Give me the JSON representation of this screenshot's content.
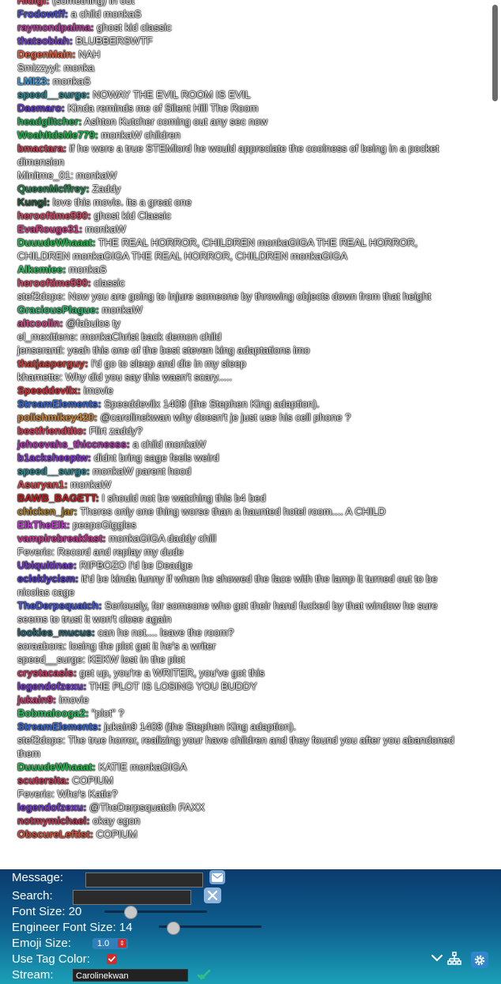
{
  "messages": [
    {
      "user": "Hidigi",
      "color": "#e0425d",
      "text": "(something) in out"
    },
    {
      "user": "Frodowtff",
      "color": "#4f4fd8",
      "text": "a child monkaS"
    },
    {
      "user": "raymondpalma",
      "color": "#c23ea4",
      "text": "ghost kid classic"
    },
    {
      "user": "thatsobiah",
      "color": "#7c45d8",
      "text": "BLUBBERSWTF"
    },
    {
      "user": "DegenMain",
      "color": "#f06545",
      "text": "NAH"
    },
    {
      "user": "",
      "color": "",
      "text": "Smizzyyl: monka"
    },
    {
      "user": "LMI23",
      "color": "#3fa4e8",
      "text": "monkaS"
    },
    {
      "user": "speed__surge",
      "color": "#2a8f9a",
      "text": "NOWAY THE EVIL ROOM IS EVIL"
    },
    {
      "user": "Daemaro",
      "color": "#6a3bd8",
      "text": "Kinda reminds me of Silent Hill The Room"
    },
    {
      "user": "headglitcher",
      "color": "#28b85c",
      "text": "Ashton Kutcher coming out any sec now"
    },
    {
      "user": "WoahItdsMe779",
      "color": "#1ebe4c",
      "text": "monkaW children"
    },
    {
      "user": "bmactara",
      "color": "#d8405a",
      "text": "if he were a true STEMlord he would appreciate the coolness of being in a pocket dimension"
    },
    {
      "user": "",
      "color": "",
      "text": "Minitme_01: monkaW"
    },
    {
      "user": "QueenMcffrey",
      "color": "#2e8b57",
      "text": "Zaddy"
    },
    {
      "user": "Kungi",
      "color": "#2a5a3a",
      "text": "love this movie. its a great one"
    },
    {
      "user": "herooftime590",
      "color": "#d84a6a",
      "text": "ghost kid Classic"
    },
    {
      "user": "EvaRouge31",
      "color": "#d8408a",
      "text": "monkaW"
    },
    {
      "user": "DuuudeWhaaat",
      "color": "#24c450",
      "text": "THE REAL HORROR, CHILDREN monkaGIGA THE REAL HORROR, CHILDREN monkaGIGA THE REAL HORROR, CHILDREN monkaGIGA"
    },
    {
      "user": "Alkemiee",
      "color": "#28c860",
      "text": "monkaS"
    },
    {
      "user": "herooftime590",
      "color": "#d84a6a",
      "text": "classic"
    },
    {
      "user": "",
      "color": "",
      "text": "stef2dope: Now you are going to injure someone by throwing objects down from that height"
    },
    {
      "user": "GraciousPlague",
      "color": "#2ec070",
      "text": "monkaW"
    },
    {
      "user": "altcoolin",
      "color": "#d84a8a",
      "text": "@fabulos ty"
    },
    {
      "user": "",
      "color": "",
      "text": "el_mexitiene: monkaChrist back demon child"
    },
    {
      "user": "",
      "color": "",
      "text": "jenseranti: yeah this one of the best steven king adaptations imo"
    },
    {
      "user": "thatjasperguy",
      "color": "#d8403a",
      "text": "I'd go to sleep and die in my sleep"
    },
    {
      "user": "",
      "color": "",
      "text": "khamette: Why did you say this wasn't scary....."
    },
    {
      "user": "Speeddevilx",
      "color": "#e0303a",
      "text": "imovie"
    },
    {
      "user": "StreamElements",
      "color": "#3a6ae0",
      "text": "Speeddevilx 1408 (the Stephen King adaption)."
    },
    {
      "user": "polishmikey420",
      "color": "#d88a3a",
      "text": "@carolinekwan why doesn't je just use his cell phone ?"
    },
    {
      "user": "bestfriendtito",
      "color": "#e0405a",
      "text": "Flirt zaddy?"
    },
    {
      "user": "jehoevahs_thiccnesss",
      "color": "#b83ab8",
      "text": "a child monkaW"
    },
    {
      "user": "b1acksheeptw",
      "color": "#8a3ad8",
      "text": "didnt bring sage feels weird"
    },
    {
      "user": "speed__surge",
      "color": "#2a8f9a",
      "text": "monkaW parent hood"
    },
    {
      "user": "Asuryan1",
      "color": "#e04a4a",
      "text": "monkaW"
    },
    {
      "user": "BAWB_BAGETT",
      "color": "#c82020",
      "text": "I should not be watching this b4 bed"
    },
    {
      "user": "chicken_jar",
      "color": "#b8862a",
      "text": "Theres only one thing worse than a haunted hotel room.... A CHILD"
    },
    {
      "user": "ElkTheElk",
      "color": "#c83ad8",
      "text": "peepoGiggles"
    },
    {
      "user": "vampirebreakfast",
      "color": "#d83a9a",
      "text": "monkaGIGA daddy chill"
    },
    {
      "user": "",
      "color": "",
      "text": "Feverio: Record and replay my dude"
    },
    {
      "user": "Ubiquitinae",
      "color": "#7a3ad8",
      "text": "RIPBOZO I'd be Deadge"
    },
    {
      "user": "ecleklycism",
      "color": "#5a3ad8",
      "text": "it'd be kinda funny if when he showed the face with the lamp it turned out to be nicolas cage"
    },
    {
      "user": "TheDerpsquatch",
      "color": "#4a5ae0",
      "text": "Seriously, for someone who got their hand fucked by that window he sure seems to trust it won't close again"
    },
    {
      "user": "lookies_mucus",
      "color": "#2a6a7a",
      "text": "can he not.... leave the room?"
    },
    {
      "user": "",
      "color": "",
      "text": "soraabora: losing the plot get it he's a writer"
    },
    {
      "user": "",
      "color": "",
      "text": "speed__surge: KEKW lost in the plot"
    },
    {
      "user": "crystacasis",
      "color": "#d83a6a",
      "text": "get up, you're a WRITER, you've got this"
    },
    {
      "user": "legendofzexu",
      "color": "#7a3ad8",
      "text": "THE PLOT IS LOSING YOU BUDDY"
    },
    {
      "user": "jukain9",
      "color": "#d83a7a",
      "text": "imovie"
    },
    {
      "user": "Bobmalooga2",
      "color": "#28c860",
      "text": "\"plot\" ?"
    },
    {
      "user": "StreamElements",
      "color": "#3a6ae0",
      "text": "jukain9 1408 (the Stephen King adaption)."
    },
    {
      "user": "",
      "color": "",
      "text": "stef2dope: The true horror, realizing your have children and they found you after you abandoned them"
    },
    {
      "user": "DuuudeWhaaat",
      "color": "#24c450",
      "text": "KATIE monkaGIGA"
    },
    {
      "user": "scutersita",
      "color": "#d83a5a",
      "text": "COPIUM"
    },
    {
      "user": "",
      "color": "",
      "text": "Feverio: Who's Katie?"
    },
    {
      "user": "legendofzexu",
      "color": "#7a3ad8",
      "text": "@TheDerpsquatch FAXX"
    },
    {
      "user": "notmymichael",
      "color": "#c83a5a",
      "text": "okay egon"
    },
    {
      "user": "ObscureLeftist",
      "color": "#e0503a",
      "text": "COPIUM"
    }
  ],
  "panel": {
    "message_label": "Message:",
    "message_value": "",
    "message_icon": "envelope-icon",
    "search_label": "Search:",
    "search_value": "",
    "search_icon": "close-icon",
    "font_size_label": "Font Size: 20",
    "font_size_value": 20,
    "engineer_font_size_label": "Engineer Font Size: 14",
    "engineer_font_size_value": 14,
    "emoji_size_label": "Emoji Size:",
    "emoji_size_value": "1.0",
    "use_tag_color_label": "Use Tag Color:",
    "use_tag_color_checked": true,
    "stream_label": "Stream:",
    "stream_value": "Carolinekwan",
    "stream_status_icon": "check-verified-icon",
    "collapse_icon": "chevron-down-icon",
    "network_icon": "network-icon",
    "settings_icon": "gear-icon"
  },
  "colors": {
    "panel_top": "#0b3a6e",
    "panel_bottom": "#1ba0b8",
    "checkbox_red": "#d42a2a",
    "verified_green": "#2ec08a"
  }
}
